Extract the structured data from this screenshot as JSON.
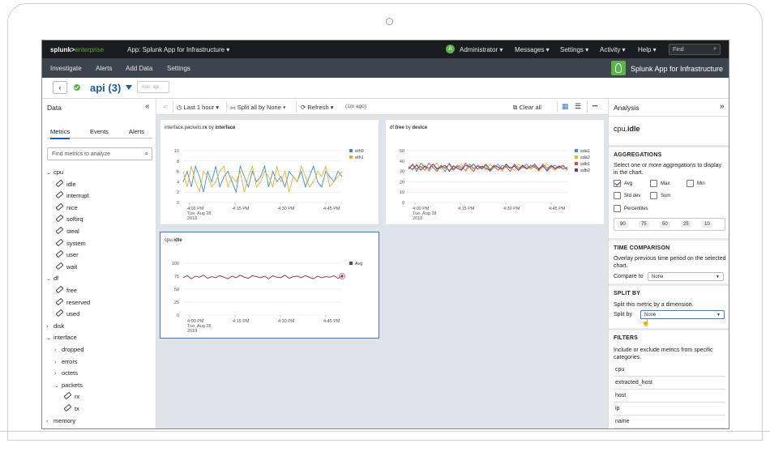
{
  "topbar": {
    "logo_a": "splunk>",
    "logo_b": "enterprise",
    "app_menu": "App: Splunk App for Infrastructure ▾",
    "avatar_letter": "A",
    "user_menu": "Administrator ▾",
    "messages": "Messages ▾",
    "settings": "Settings ▾",
    "activity": "Activity ▾",
    "help": "Help ▾",
    "find_placeholder": "Find"
  },
  "navbar": {
    "items": [
      "Investigate",
      "Alerts",
      "Add Data",
      "Settings"
    ],
    "app_title": "Splunk App for Infrastructure"
  },
  "header": {
    "back": "‹",
    "title": "api (3)",
    "role": "role: api"
  },
  "left": {
    "title": "Data",
    "collapse": "«",
    "tabs": [
      "Metrics",
      "Events",
      "Alerts"
    ],
    "search_placeholder": "Find metrics to analyze",
    "tree": [
      {
        "label": "cpu",
        "type": "folder",
        "open": true,
        "depth": 0
      },
      {
        "label": "idle",
        "type": "leaf",
        "depth": 1
      },
      {
        "label": "interrupt",
        "type": "leaf",
        "depth": 1
      },
      {
        "label": "nice",
        "type": "leaf",
        "depth": 1
      },
      {
        "label": "softirq",
        "type": "leaf",
        "depth": 1
      },
      {
        "label": "steal",
        "type": "leaf",
        "depth": 1
      },
      {
        "label": "system",
        "type": "leaf",
        "depth": 1
      },
      {
        "label": "user",
        "type": "leaf",
        "depth": 1
      },
      {
        "label": "wait",
        "type": "leaf",
        "depth": 1
      },
      {
        "label": "df",
        "type": "folder",
        "open": true,
        "depth": 0
      },
      {
        "label": "free",
        "type": "leaf",
        "depth": 1
      },
      {
        "label": "reserved",
        "type": "leaf",
        "depth": 1
      },
      {
        "label": "used",
        "type": "leaf",
        "depth": 1
      },
      {
        "label": "disk",
        "type": "folder",
        "open": false,
        "depth": 0
      },
      {
        "label": "interface",
        "type": "folder",
        "open": true,
        "depth": 0
      },
      {
        "label": "dropped",
        "type": "folder",
        "open": false,
        "depth": 1
      },
      {
        "label": "errors",
        "type": "folder",
        "open": false,
        "depth": 1
      },
      {
        "label": "octets",
        "type": "folder",
        "open": false,
        "depth": 1
      },
      {
        "label": "packets",
        "type": "folder",
        "open": true,
        "depth": 1
      },
      {
        "label": "rx",
        "type": "leaf",
        "depth": 2
      },
      {
        "label": "tx",
        "type": "leaf",
        "depth": 2
      },
      {
        "label": "memory",
        "type": "folder",
        "open": false,
        "depth": 0
      }
    ]
  },
  "toolbar": {
    "time": "Last 1 hour",
    "split": "Split all by None",
    "refresh": "Refresh",
    "ago": "(1m ago)",
    "clear": "Clear all",
    "more": "•••"
  },
  "panels": [
    {
      "title_a": "interface.packets.",
      "title_b": "rx",
      "title_c": " by ",
      "title_d": "interface"
    },
    {
      "title_a": "df.",
      "title_b": "free",
      "title_c": " by ",
      "title_d": "device"
    },
    {
      "title_a": "cpu.",
      "title_b": "idle",
      "title_c": "",
      "title_d": ""
    }
  ],
  "chart_data": [
    {
      "type": "line",
      "title": "interface.packets.rx by interface",
      "x": [
        "4:00 PM Tue, Aug 28 2018",
        "4:15 PM",
        "4:30 PM",
        "4:45 PM"
      ],
      "ylim": [
        0,
        10
      ],
      "yticks": [
        0,
        2,
        4,
        6,
        8,
        10
      ],
      "series": [
        {
          "name": "eth0",
          "color": "#3b8fce",
          "values": [
            4,
            6,
            3,
            7,
            5,
            2,
            6,
            4,
            7,
            3,
            5,
            6,
            4,
            2,
            7,
            5,
            3,
            6,
            4,
            5,
            7,
            3,
            6,
            4,
            5,
            3,
            6,
            5,
            4,
            6,
            3,
            5,
            7,
            4,
            3,
            6,
            5,
            4,
            6,
            5
          ]
        },
        {
          "name": "eth1",
          "color": "#e3b330",
          "values": [
            6,
            3,
            7,
            4,
            2,
            6,
            5,
            3,
            4,
            6,
            7,
            3,
            5,
            4,
            6,
            2,
            5,
            7,
            3,
            4,
            6,
            5,
            3,
            7,
            4,
            6,
            2,
            5,
            4,
            7,
            5,
            3,
            4,
            6,
            5,
            7,
            3,
            4,
            5,
            6
          ]
        }
      ]
    },
    {
      "type": "line",
      "title": "df.free by device",
      "x": [
        "4:00 PM Tue, Aug 28 2018",
        "4:15 PM",
        "4:30 PM",
        "4:45 PM"
      ],
      "ylim": [
        0,
        50
      ],
      "yticks": [
        0,
        10,
        20,
        30,
        40,
        50
      ],
      "series": [
        {
          "name": "sda1",
          "color": "#3b8fce",
          "values": [
            32,
            36,
            30,
            38,
            34,
            31,
            37,
            33,
            35,
            30,
            38,
            32,
            36,
            34,
            31,
            37,
            33,
            35,
            32,
            36,
            30,
            34,
            37,
            32,
            35,
            33,
            36,
            31,
            34,
            37,
            32,
            35,
            33,
            36,
            30,
            34,
            36,
            33,
            35,
            32
          ]
        },
        {
          "name": "sda2",
          "color": "#e3b330",
          "values": [
            35,
            31,
            37,
            33,
            36,
            30,
            34,
            38,
            32,
            35,
            31,
            36,
            33,
            37,
            30,
            35,
            32,
            36,
            34,
            31,
            37,
            33,
            35,
            30,
            36,
            34,
            31,
            37,
            33,
            35,
            32,
            36,
            30,
            34,
            37,
            33,
            31,
            36,
            34,
            33
          ]
        },
        {
          "name": "sdb1",
          "color": "#d4503e",
          "values": [
            33,
            37,
            32,
            35,
            31,
            38,
            34,
            30,
            36,
            33,
            37,
            31,
            35,
            32,
            38,
            34,
            30,
            36,
            33,
            37,
            32,
            35,
            31,
            36,
            34,
            30,
            37,
            33,
            35,
            32,
            36,
            34,
            31,
            37,
            33,
            35,
            32,
            34,
            36,
            31
          ]
        },
        {
          "name": "sdb2",
          "color": "#6c3b7e",
          "values": [
            34,
            32,
            36,
            31,
            35,
            33,
            37,
            32,
            34,
            36,
            30,
            35,
            33,
            31,
            36,
            34,
            37,
            32,
            35,
            33,
            31,
            36,
            34,
            32,
            37,
            33,
            35,
            31,
            36,
            33,
            34,
            37,
            32,
            35,
            31,
            36,
            33,
            35,
            32,
            34
          ]
        }
      ]
    },
    {
      "type": "line",
      "title": "cpu.idle",
      "x": [
        "4:00 PM Tue, Aug 28 2018",
        "4:15 PM",
        "4:30 PM",
        "4:45 PM"
      ],
      "ylim": [
        0,
        100
      ],
      "yticks": [
        0,
        25,
        50,
        75,
        100
      ],
      "series": [
        {
          "name": "Avg",
          "color": "#8a2f5a",
          "values": [
            72,
            76,
            70,
            75,
            73,
            77,
            71,
            74,
            72,
            76,
            73,
            70,
            75,
            72,
            77,
            73,
            71,
            76,
            74,
            72,
            75,
            70,
            76,
            73,
            72,
            77,
            71,
            74,
            75,
            72,
            76,
            73,
            70,
            75,
            72,
            74,
            73,
            76,
            71,
            75
          ]
        }
      ]
    }
  ],
  "x_ticks": {
    "t0_a": "4:00 PM",
    "t0_b": "Tue, Aug 28",
    "t0_c": "2018",
    "t1": "4:15 PM",
    "t2": "4:30 PM",
    "t3": "4:45 PM"
  },
  "right": {
    "title": "Analysis",
    "collapse": "»",
    "metric_a": "cpu.",
    "metric_b": "idle",
    "aggregations": {
      "heading": "AGGREGATIONS",
      "desc": "Select one or more aggregations to display in the chart.",
      "options": [
        {
          "label": "Avg",
          "checked": true
        },
        {
          "label": "Max",
          "checked": false
        },
        {
          "label": "Min",
          "checked": false
        },
        {
          "label": "Std dev",
          "checked": false
        },
        {
          "label": "Sum",
          "checked": false
        },
        {
          "label": "Percentiles",
          "checked": false
        }
      ],
      "percentiles": [
        "90",
        "75",
        "50",
        "25",
        "10"
      ]
    },
    "time_comparison": {
      "heading": "TIME COMPARISON",
      "desc": "Overlay previous time period on the selected chart.",
      "compare_label": "Compare to",
      "compare_value": "None"
    },
    "split_by": {
      "heading": "SPLIT BY",
      "desc": "Split this metric by a dimension.",
      "label": "Split by",
      "value": "None"
    },
    "filters": {
      "heading": "FILTERS",
      "desc": "Include or exclude metrics from specific categories.",
      "items": [
        "cpu",
        "extracted_host",
        "host",
        "ip",
        "name"
      ]
    }
  }
}
